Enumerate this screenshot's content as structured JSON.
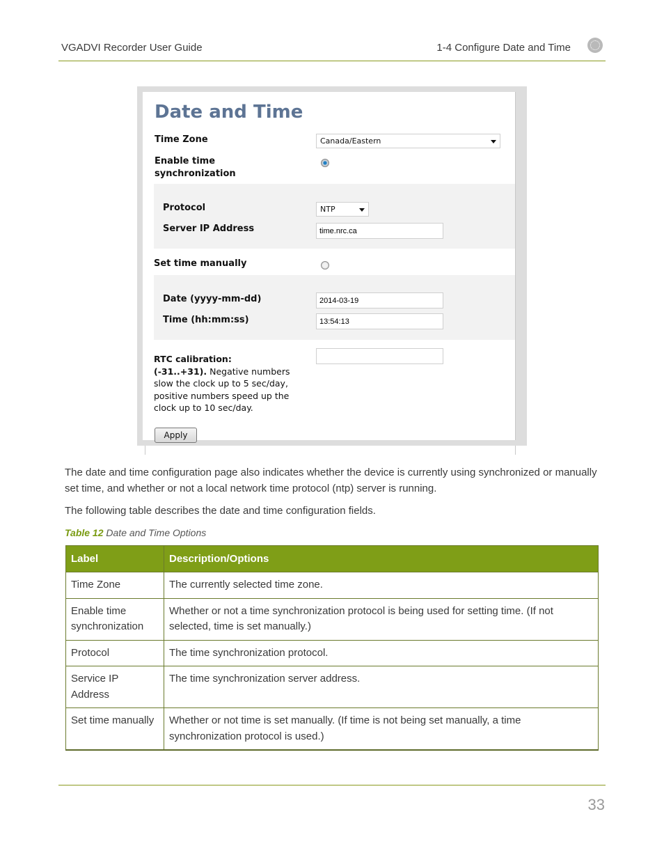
{
  "header": {
    "doc_title": "VGADVI Recorder User Guide",
    "section": "1-4  Configure Date and Time",
    "icon": "epiphan-logo-icon"
  },
  "screenshot": {
    "title": "Date and Time",
    "time_zone": {
      "label": "Time Zone",
      "value": "Canada/Eastern"
    },
    "enable_sync": {
      "label_line1": "Enable time",
      "label_line2": "synchronization",
      "selected": true
    },
    "protocol": {
      "label": "Protocol",
      "value": "NTP"
    },
    "server_ip": {
      "label": "Server IP Address",
      "value": "time.nrc.ca"
    },
    "set_manual": {
      "label": "Set time manually",
      "selected": false
    },
    "date": {
      "label": "Date (yyyy-mm-dd)",
      "value": "2014-03-19"
    },
    "time": {
      "label": "Time (hh:mm:ss)",
      "value": "13:54:13"
    },
    "rtc": {
      "label_bold1": "RTC calibration:",
      "label_bold2": "(-31..+31).",
      "label_text": " Negative numbers slow the clock up to 5 sec/day, positive numbers speed up the clock up to 10 sec/day.",
      "value": ""
    },
    "apply_label": "Apply"
  },
  "body": {
    "para1": "The date and time configuration page also indicates whether the device is currently using synchronized or manually set time, and whether or not a local network time protocol (ntp) server is running.",
    "para2": "The following table describes the date and time configuration fields.",
    "caption_num": "Table 12",
    "caption_text": " Date and Time Options"
  },
  "table": {
    "headers": [
      "Label",
      "Description/Options"
    ],
    "rows": [
      [
        "Time Zone",
        "The currently selected time zone."
      ],
      [
        "Enable time synchronization",
        "Whether or not a time synchronization protocol is being used for setting time. (If not selected, time is set manually.)"
      ],
      [
        "Protocol",
        "The time synchronization protocol."
      ],
      [
        "Service IP Address",
        "The time synchronization server address."
      ],
      [
        "Set time manually",
        "Whether or not time is set manually. (If time is not being set manually, a time synchronization protocol is used.)"
      ]
    ]
  },
  "footer": {
    "page_number": "33"
  }
}
